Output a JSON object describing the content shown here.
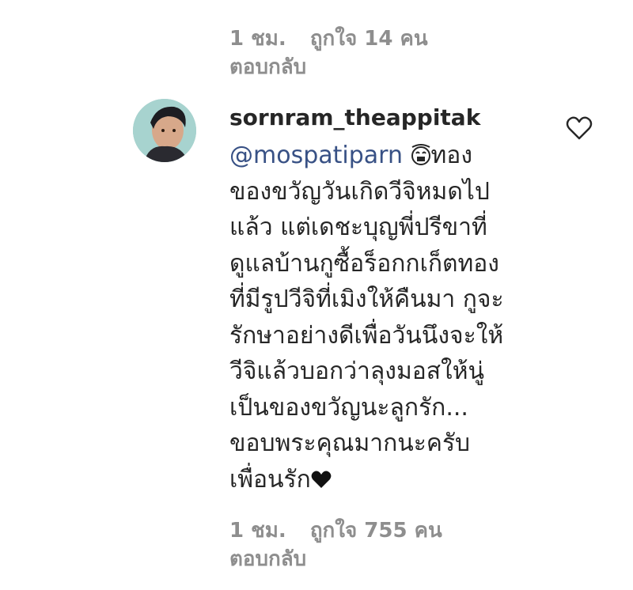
{
  "top_comment": {
    "time": "1 ชม.",
    "likes": "ถูกใจ 14 คน",
    "reply": "ตอบกลับ"
  },
  "comment": {
    "avatar_icon": "user-avatar",
    "username": "sornram_theappitak",
    "mention": "@mospatiparn",
    "emoji_icon": "crying-face-icon",
    "first_line_text": "ทอง",
    "body_lines": "ของขวัญวันเกิดวีจิหมดไป\nแล้ว แต่เดชะบุญพี่ปรีขาที่\nดูแลบ้านกูซื้อร็อกกเก็ตทอง\nที่มีรูปวีจิที่เมิงให้คืนมา กูจะ\nรักษาอย่างดีเพื่อวันนึงจะให้\nวีจิแล้วบอกว่าลุงมอสให้นู่\nเป็นของขวัญนะลูกรัก...\nขอบพระคุณมากนะครับ\nเพื่อนรัก",
    "end_icon": "black-heart-icon",
    "like_icon": "heart-outline-icon",
    "time": "1 ชม.",
    "likes": "ถูกใจ 755 คน",
    "reply": "ตอบกลับ"
  },
  "colors": {
    "meta_text": "#8e8e8e",
    "mention": "#385185",
    "body_text": "#262626"
  }
}
